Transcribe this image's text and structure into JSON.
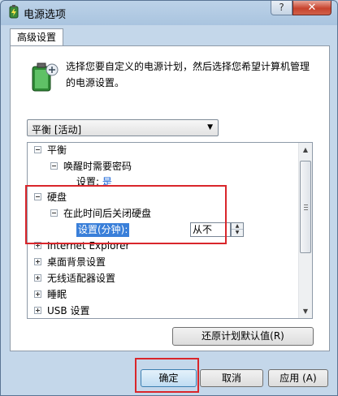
{
  "window": {
    "title": "电源选项",
    "help_label": "?",
    "close_label": "✕",
    "icon": "power-options-icon"
  },
  "tab": {
    "label": "高级设置"
  },
  "intro_icon": "battery-plan-icon",
  "intro_text": "选择您要自定义的电源计划，然后选择您希望计算机管理的电源设置。",
  "plan_select": {
    "value": "平衡 [活动]"
  },
  "tree": {
    "items": [
      {
        "label": "平衡",
        "expander": "−"
      },
      {
        "label": "唤醒时需要密码",
        "expander": "−"
      },
      {
        "label": "设置:",
        "value": "是"
      },
      {
        "label": "硬盘",
        "expander": "−"
      },
      {
        "label": "在此时间后关闭硬盘",
        "expander": "−"
      },
      {
        "label": "设置(分钟):",
        "value": "从不"
      },
      {
        "label": "Internet Explorer",
        "expander": "+"
      },
      {
        "label": "桌面背景设置",
        "expander": "+"
      },
      {
        "label": "无线适配器设置",
        "expander": "+"
      },
      {
        "label": "睡眠",
        "expander": "+"
      },
      {
        "label": "USB 设置",
        "expander": "+"
      }
    ],
    "spin_up": "▲",
    "spin_down": "▼",
    "scroll_up": "▲",
    "scroll_down": "▼"
  },
  "buttons": {
    "restore": "还原计划默认值(R)",
    "ok": "确定",
    "cancel": "取消",
    "apply": "应用 (A)"
  },
  "colors": {
    "highlight_box": "#d9262b",
    "selection": "#3a7fd9",
    "link": "#0b5bd7"
  }
}
